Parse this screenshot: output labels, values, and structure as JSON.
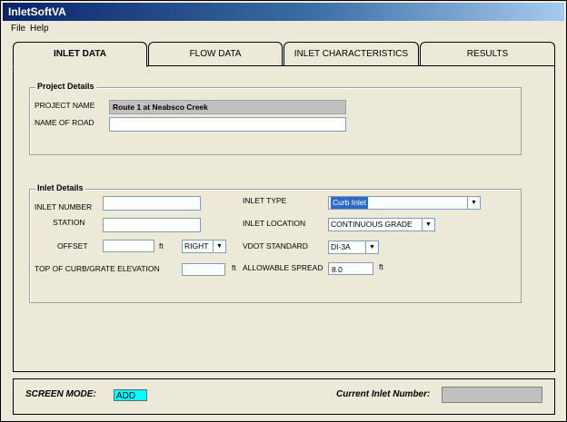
{
  "window": {
    "title": "InletSoftVA"
  },
  "menu": {
    "file": "File",
    "help": "Help"
  },
  "tabs": [
    {
      "label": "INLET DATA",
      "active": true
    },
    {
      "label": "FLOW DATA",
      "active": false
    },
    {
      "label": "INLET CHARACTERISTICS",
      "active": false
    },
    {
      "label": "RESULTS",
      "active": false
    }
  ],
  "project": {
    "title": "Project Details",
    "project_name_label": "PROJECT NAME",
    "project_name_value": "Route 1 at Neabsco Creek",
    "road_label": "NAME OF ROAD",
    "road_value": ""
  },
  "inlet": {
    "title": "Inlet Details",
    "number_label": "INLET NUMBER",
    "number_value": "",
    "station_label": "STATION",
    "station_value": "",
    "offset_label": "OFFSET",
    "offset_value": "",
    "offset_unit": "ft",
    "offset_side": "RIGHT",
    "tc_label": "TOP OF CURB/GRATE ELEVATION",
    "tc_value": "",
    "tc_unit": "ft",
    "type_label": "INLET TYPE",
    "type_value": "Curb Inlet",
    "location_label": "INLET LOCATION",
    "location_value": "CONTINUOUS GRADE",
    "vdot_label": "VDOT STANDARD",
    "vdot_value": "DI-3A",
    "spread_label": "ALLOWABLE SPREAD",
    "spread_value": "8.0",
    "spread_unit": "ft"
  },
  "status": {
    "mode_label": "SCREEN MODE:",
    "mode_value": "ADD",
    "current_inlet_label": "Current Inlet Number:",
    "current_inlet_value": ""
  }
}
